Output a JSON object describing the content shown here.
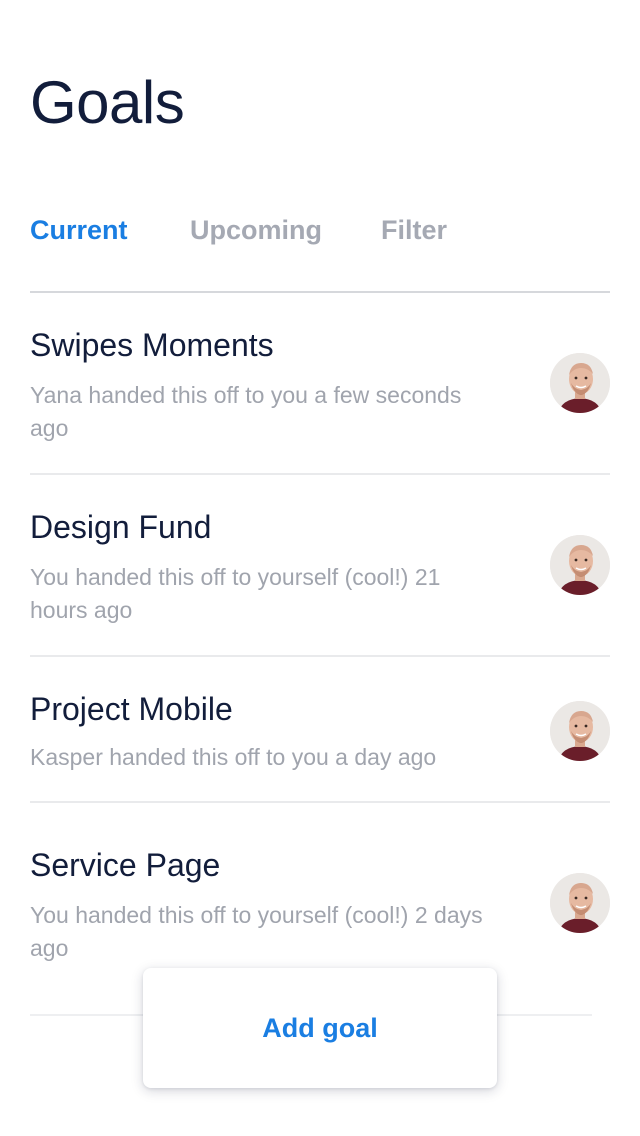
{
  "header": {
    "title": "Goals"
  },
  "tabs": [
    {
      "label": "Current",
      "active": true
    },
    {
      "label": "Upcoming",
      "active": false
    },
    {
      "label": "Filter",
      "active": false
    }
  ],
  "goals": [
    {
      "title": "Swipes Moments",
      "subtitle": "Yana handed this off to you a few seconds ago",
      "avatar_icon": "user-avatar-photo"
    },
    {
      "title": "Design Fund",
      "subtitle": "You handed this off to yourself (cool!) 21 hours ago",
      "avatar_icon": "user-avatar-photo"
    },
    {
      "title": "Project Mobile",
      "subtitle": "Kasper handed this off to you a day ago",
      "avatar_icon": "user-avatar-photo"
    },
    {
      "title": "Service Page",
      "subtitle": "You handed this off to yourself (cool!) 2 days ago",
      "avatar_icon": "user-avatar-photo"
    }
  ],
  "actions": {
    "add_goal_label": "Add goal"
  },
  "colors": {
    "accent": "#1a7ee2",
    "title_text": "#121d3b",
    "muted_text": "#a0a4ad",
    "divider": "#e9eaec"
  }
}
